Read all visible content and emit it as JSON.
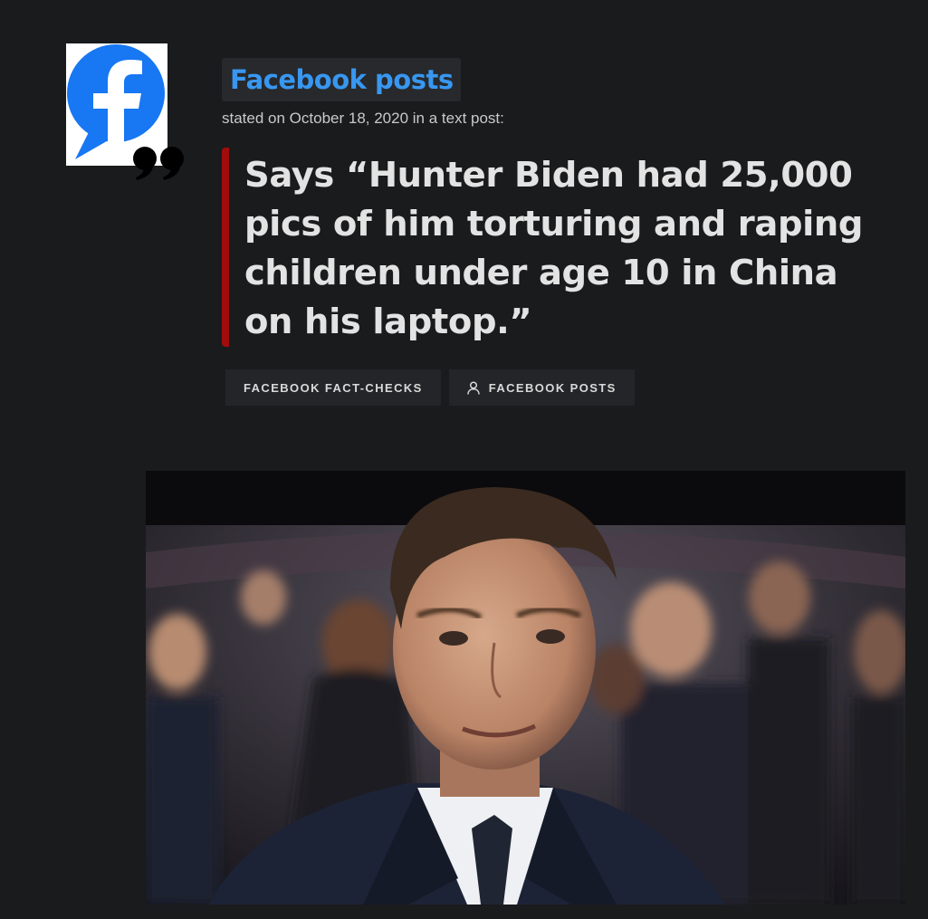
{
  "speaker": {
    "name": "Facebook posts",
    "avatar_icon": "facebook-logo-icon",
    "quote_icon": "quotation-mark-icon",
    "stated_line": "stated on October 18, 2020 in a text post:",
    "name_color": "#3897f0"
  },
  "statement": {
    "text": "Says “Hunter Biden had 25,000 pics of him torturing and raping children under age 10 in China on his laptop.”",
    "accent_color": "#a10c0c"
  },
  "tags": [
    {
      "label": "FACEBOOK FACT-CHECKS",
      "icon": ""
    },
    {
      "label": "FACEBOOK POSTS",
      "icon": "person-icon"
    }
  ],
  "photo": {
    "subject": "news photo of a man in a dark suit seated in an audience"
  },
  "colors": {
    "background": "#1a1b1d",
    "text": "#e3e3e3",
    "facebook_blue": "#1877f2"
  }
}
